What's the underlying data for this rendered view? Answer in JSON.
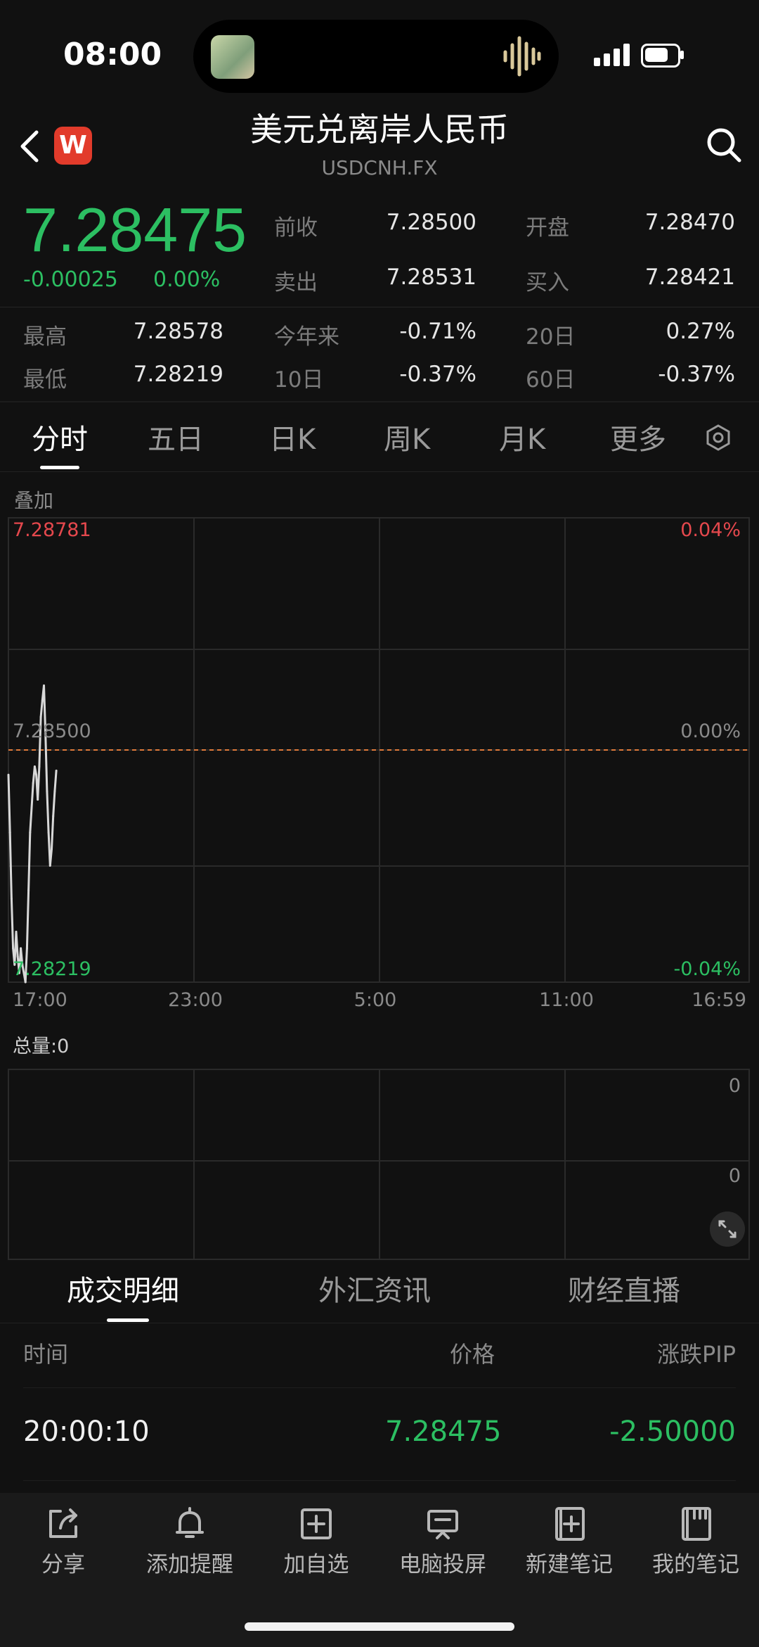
{
  "status_bar": {
    "time": "08:00"
  },
  "header": {
    "logo_letter": "W",
    "title": "美元兑离岸人民币",
    "subtitle": "USDCNH.FX"
  },
  "quote": {
    "price": "7.28475",
    "change": "-0.00025",
    "change_pct": "0.00%",
    "stats": [
      {
        "label": "前收",
        "value": "7.28500"
      },
      {
        "label": "开盘",
        "value": "7.28470"
      },
      {
        "label": "卖出",
        "value": "7.28531"
      },
      {
        "label": "买入",
        "value": "7.28421"
      },
      {
        "label": "最高",
        "value": "7.28578"
      },
      {
        "label": "今年来",
        "value": "-0.71%"
      },
      {
        "label": "20日",
        "value": "0.27%"
      },
      {
        "label": "最低",
        "value": "7.28219"
      },
      {
        "label": "10日",
        "value": "-0.37%"
      },
      {
        "label": "60日",
        "value": "-0.37%"
      }
    ]
  },
  "tabs": [
    "分时",
    "五日",
    "日K",
    "周K",
    "月K",
    "更多"
  ],
  "chart": {
    "overlay_label": "叠加",
    "y_top": "7.28781",
    "y_mid": "7.28500",
    "y_bottom": "7.28219",
    "pct_top": "0.04%",
    "pct_mid": "0.00%",
    "pct_bottom": "-0.04%",
    "x_labels": [
      "17:00",
      "23:00",
      "5:00",
      "11:00",
      "16:59"
    ],
    "volume_label": "总量:0",
    "volume_top": "0",
    "volume_mid": "0",
    "colors": {
      "up": "#e5484d",
      "down": "#2cbf62",
      "line": "#d8d8d8",
      "baseline": "#e07a3a"
    }
  },
  "chart_data": {
    "type": "line",
    "x_range": [
      "17:00",
      "16:59"
    ],
    "x": [
      "17:00",
      "17:03",
      "17:06",
      "17:09",
      "17:12",
      "17:15",
      "17:18",
      "17:21",
      "17:24",
      "17:27",
      "17:30",
      "17:33",
      "17:36",
      "17:39",
      "17:42",
      "17:45",
      "17:48",
      "17:51",
      "17:54",
      "17:57",
      "18:00",
      "18:03",
      "18:06",
      "18:09",
      "18:12",
      "18:15",
      "18:18",
      "18:21",
      "18:24",
      "18:27",
      "18:30",
      "18:33"
    ],
    "values": [
      7.2847,
      7.284,
      7.2832,
      7.2826,
      7.2824,
      7.2828,
      7.2825,
      7.2823,
      7.2826,
      7.2824,
      7.2823,
      7.28219,
      7.2826,
      7.2833,
      7.284,
      7.2843,
      7.2846,
      7.2848,
      7.2847,
      7.2844,
      7.2848,
      7.2854,
      7.2856,
      7.28578,
      7.2852,
      7.2845,
      7.284,
      7.2836,
      7.2838,
      7.2842,
      7.2845,
      7.28475
    ],
    "ylim": [
      7.28219,
      7.28781
    ],
    "baseline": 7.285
  },
  "bottom_tabs": [
    "成交明细",
    "外汇资讯",
    "财经直播"
  ],
  "trades": {
    "headers": {
      "time": "时间",
      "price": "价格",
      "pip": "涨跌PIP"
    },
    "rows": [
      {
        "time": "20:00:10",
        "price": "7.28475",
        "pip": "-2.50000"
      }
    ]
  },
  "toolbar": [
    {
      "label": "分享",
      "icon": "share-icon"
    },
    {
      "label": "添加提醒",
      "icon": "bell-icon"
    },
    {
      "label": "加自选",
      "icon": "add-watchlist-icon"
    },
    {
      "label": "电脑投屏",
      "icon": "screen-cast-icon"
    },
    {
      "label": "新建笔记",
      "icon": "new-note-icon"
    },
    {
      "label": "我的笔记",
      "icon": "my-notes-icon"
    }
  ]
}
